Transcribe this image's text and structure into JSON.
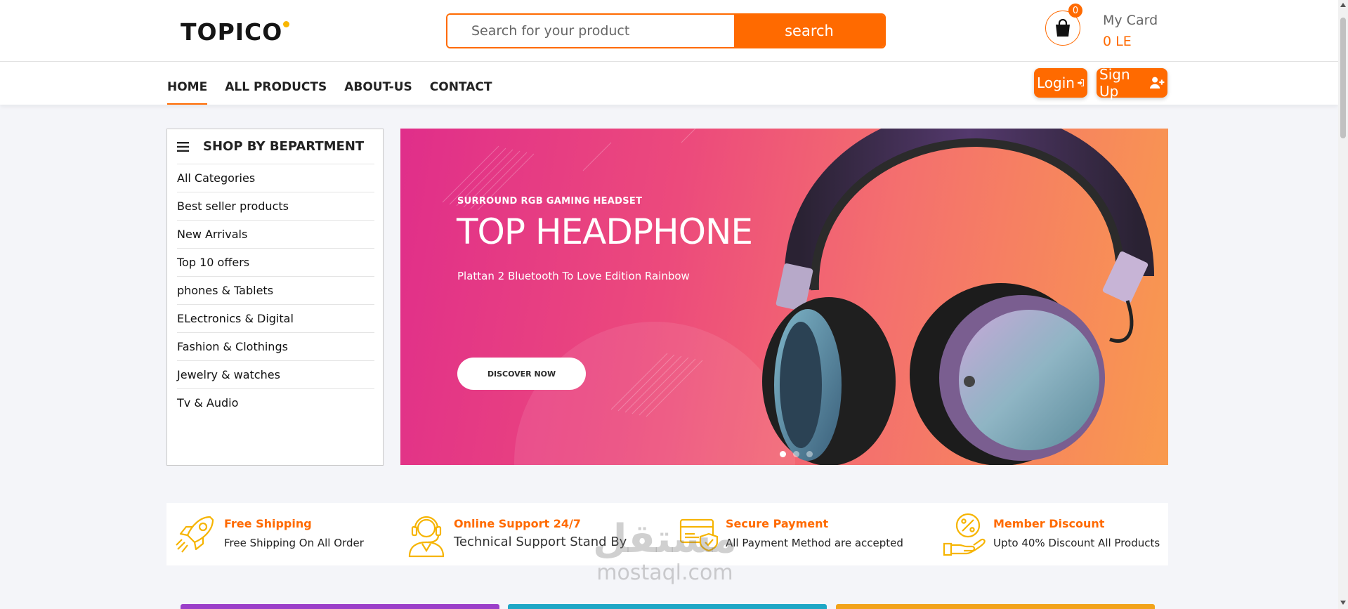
{
  "header": {
    "logo_text": "TOPICO",
    "search_placeholder": "Search for your product",
    "search_button": "search",
    "cart_count": "0",
    "cart_label": "My Card",
    "cart_total": "0 LE"
  },
  "nav": {
    "items": [
      {
        "label": "HOME",
        "active": true
      },
      {
        "label": "ALL PRODUCTS",
        "active": false
      },
      {
        "label": "ABOUT-US",
        "active": false
      },
      {
        "label": "CONTACT",
        "active": false
      }
    ],
    "login_label": "Login",
    "signup_label": "Sign Up"
  },
  "departments": {
    "title": "SHOP BY BEPARTMENT",
    "items": [
      "All Categories",
      "Best seller products",
      "New Arrivals",
      "Top 10 offers",
      "phones & Tablets",
      "ELectronics & Digital",
      "Fashion & Clothings",
      "Jewelry & watches",
      "Tv & Audio"
    ]
  },
  "hero": {
    "subtitle": "SURROUND RGB GAMING HEADSET",
    "title": "TOP HEADPHONE",
    "description": "Plattan 2 Bluetooth To Love Edition Rainbow",
    "button": "DISCOVER NOW",
    "slide_count": 3,
    "active_slide": 1
  },
  "features": [
    {
      "icon": "rocket-icon",
      "title": "Free Shipping",
      "description": "Free Shipping On All Order"
    },
    {
      "icon": "headset-support-icon",
      "title": "Online Support 24/7",
      "description": "Technical Support Stand By"
    },
    {
      "icon": "credit-card-shield-icon",
      "title": "Secure Payment",
      "description": "All Payment Method are accepted"
    },
    {
      "icon": "percent-hand-icon",
      "title": "Member Discount",
      "description": "Upto 40% Discount All Products"
    }
  ],
  "watermark": {
    "arabic": "مستقل",
    "latin": "mostaql.com"
  },
  "colors": {
    "accent": "#ff6a00",
    "feature_icon": "#f6b400",
    "card_colors": [
      "#9b3fc9",
      "#1ea7c6",
      "#f2a31a"
    ]
  }
}
